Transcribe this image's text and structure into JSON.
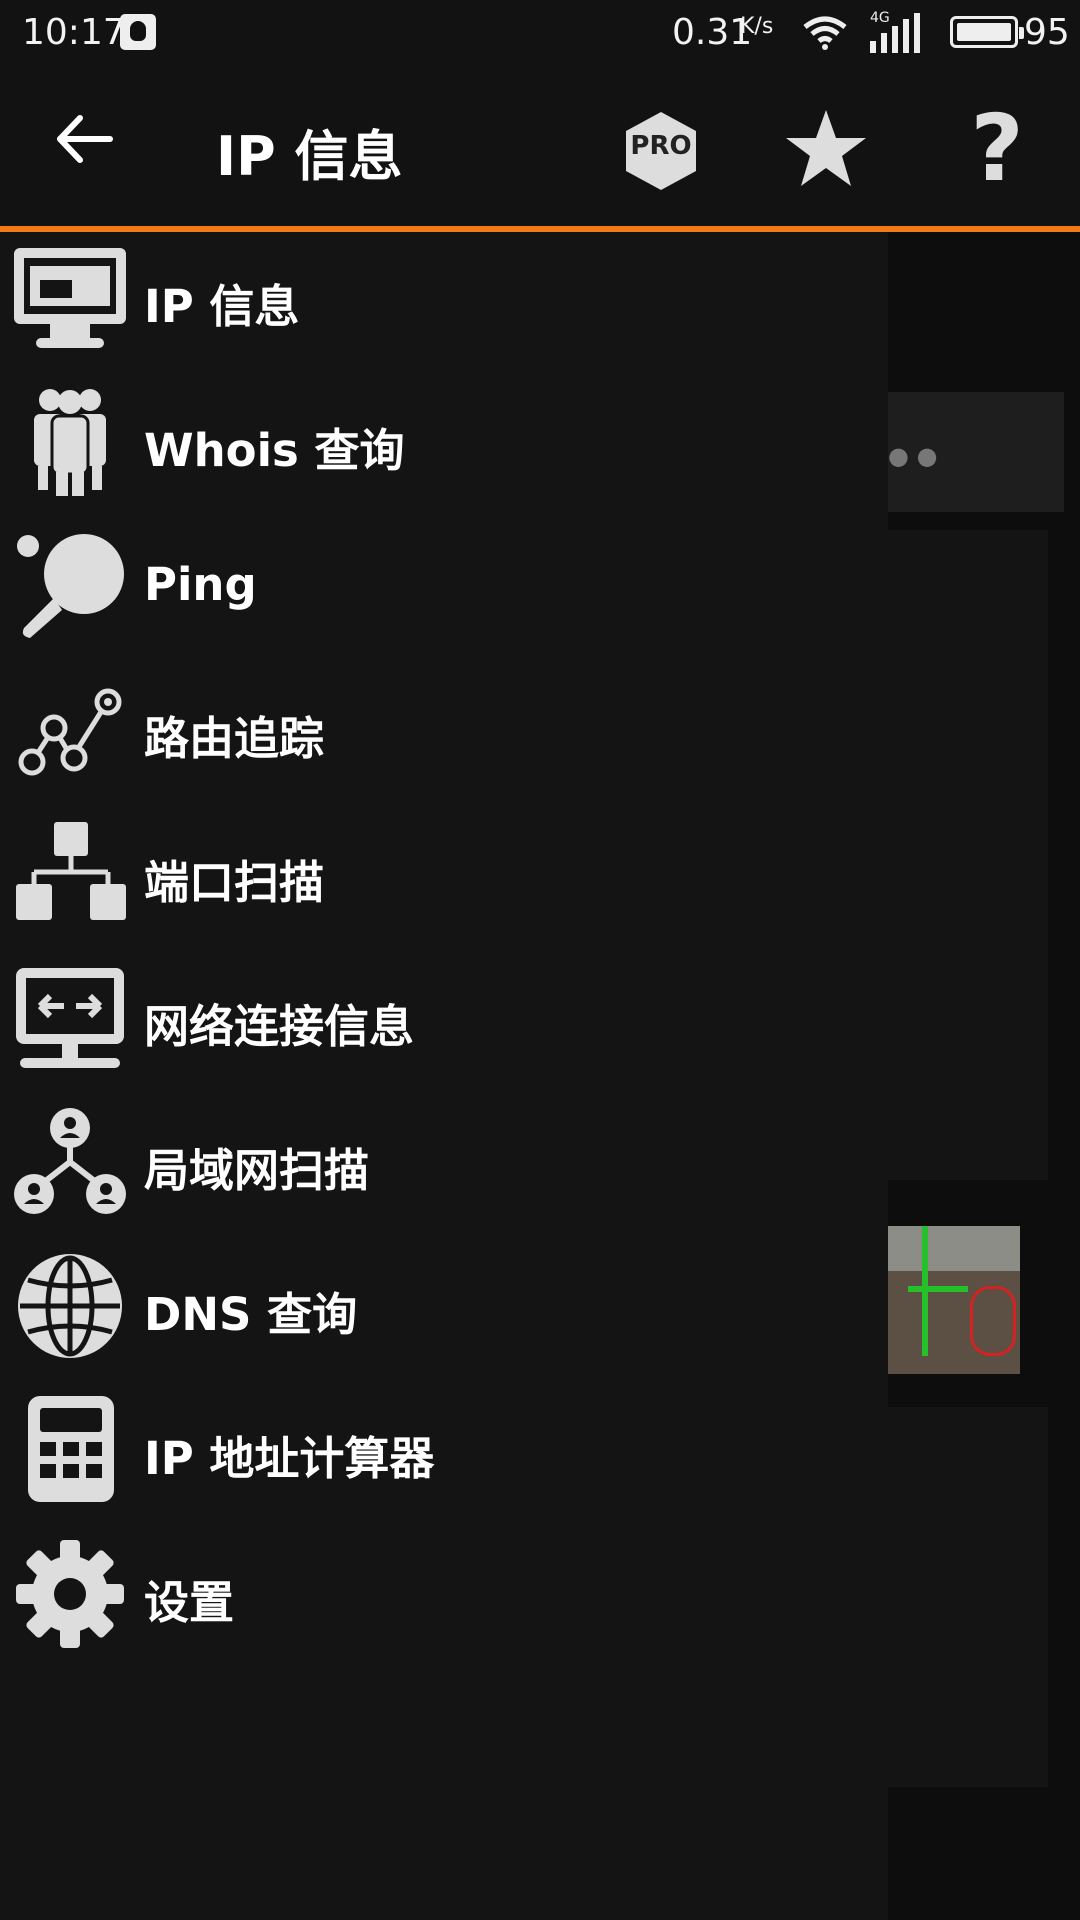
{
  "status_bar": {
    "time": "10:17",
    "net_speed": "0.31",
    "net_unit": "K/s",
    "signal_type": "4G",
    "battery": "95",
    "icons": [
      "qq-icon",
      "wifi-icon",
      "signal-icon",
      "battery-icon"
    ]
  },
  "app_bar": {
    "title": "IP 信息",
    "back_icon": "back-arrow-icon",
    "pro_label": "PRO",
    "star_icon": "star-icon",
    "help_label": "?",
    "accent_color": "#f07a16"
  },
  "drawer": {
    "items": [
      {
        "label": "IP 信息",
        "icon": "monitor-icon"
      },
      {
        "label": "Whois 查询",
        "icon": "people-icon"
      },
      {
        "label": "Ping",
        "icon": "ping-pong-icon"
      },
      {
        "label": "路由追踪",
        "icon": "route-icon"
      },
      {
        "label": "端口扫描",
        "icon": "port-scan-icon"
      },
      {
        "label": "网络连接信息",
        "icon": "network-connection-icon"
      },
      {
        "label": "局域网扫描",
        "icon": "lan-scan-icon"
      },
      {
        "label": "DNS 查询",
        "icon": "globe-icon"
      },
      {
        "label": "IP 地址计算器",
        "icon": "calculator-icon"
      },
      {
        "label": "设置",
        "icon": "gear-icon"
      }
    ]
  },
  "background": {
    "dots": "● ●"
  }
}
